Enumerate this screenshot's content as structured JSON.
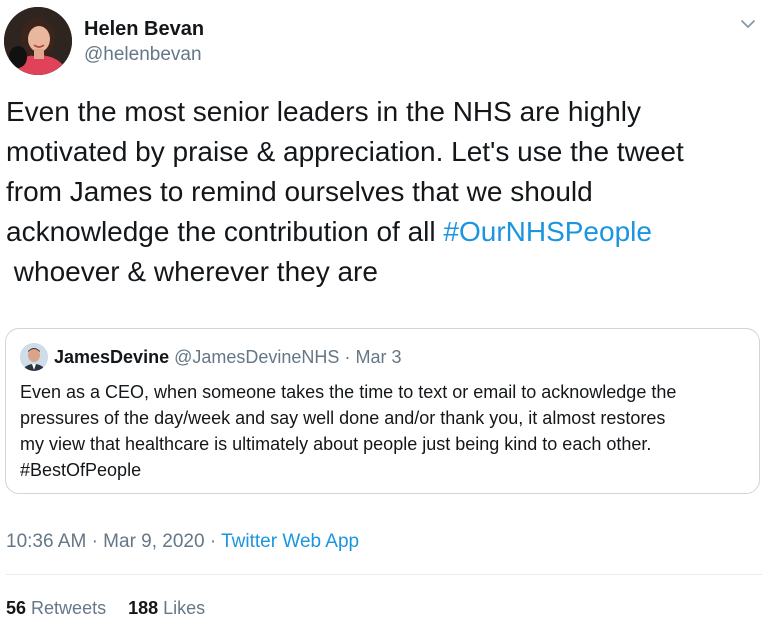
{
  "author": {
    "name": "Helen Bevan",
    "handle": "@helenbevan"
  },
  "tweet": {
    "lines": [
      "Even the most senior leaders in the NHS are highly",
      "motivated by praise & appreciation. Let's use the tweet",
      "from James to remind ourselves that we should",
      "acknowledge the contribution of all ",
      " whoever & wherever they are"
    ],
    "hashtag": "#OurNHSPeople"
  },
  "quoted_tweet": {
    "name": "JamesDevine",
    "handle": "@JamesDevineNHS",
    "separator": "·",
    "date": "Mar 3",
    "lines": [
      "Even as a CEO, when someone takes the time to text or email to acknowledge the",
      "pressures of the day/week and say well done and/or thank you, it almost restores",
      "my view that healthcare is ultimately about people just being kind to each other.",
      "#BestOfPeople"
    ]
  },
  "meta": {
    "time": "10:36 AM",
    "separator": "·",
    "date": "Mar 9, 2020",
    "app": "Twitter Web App"
  },
  "stats": {
    "retweets_count": "56",
    "retweets_label": "Retweets",
    "likes_count": "188",
    "likes_label": "Likes"
  },
  "icons": {
    "menu": "chevron-down-icon"
  },
  "colors": {
    "link": "#1b95e0",
    "secondary_text": "#657786",
    "border": "#ccd6dd"
  }
}
